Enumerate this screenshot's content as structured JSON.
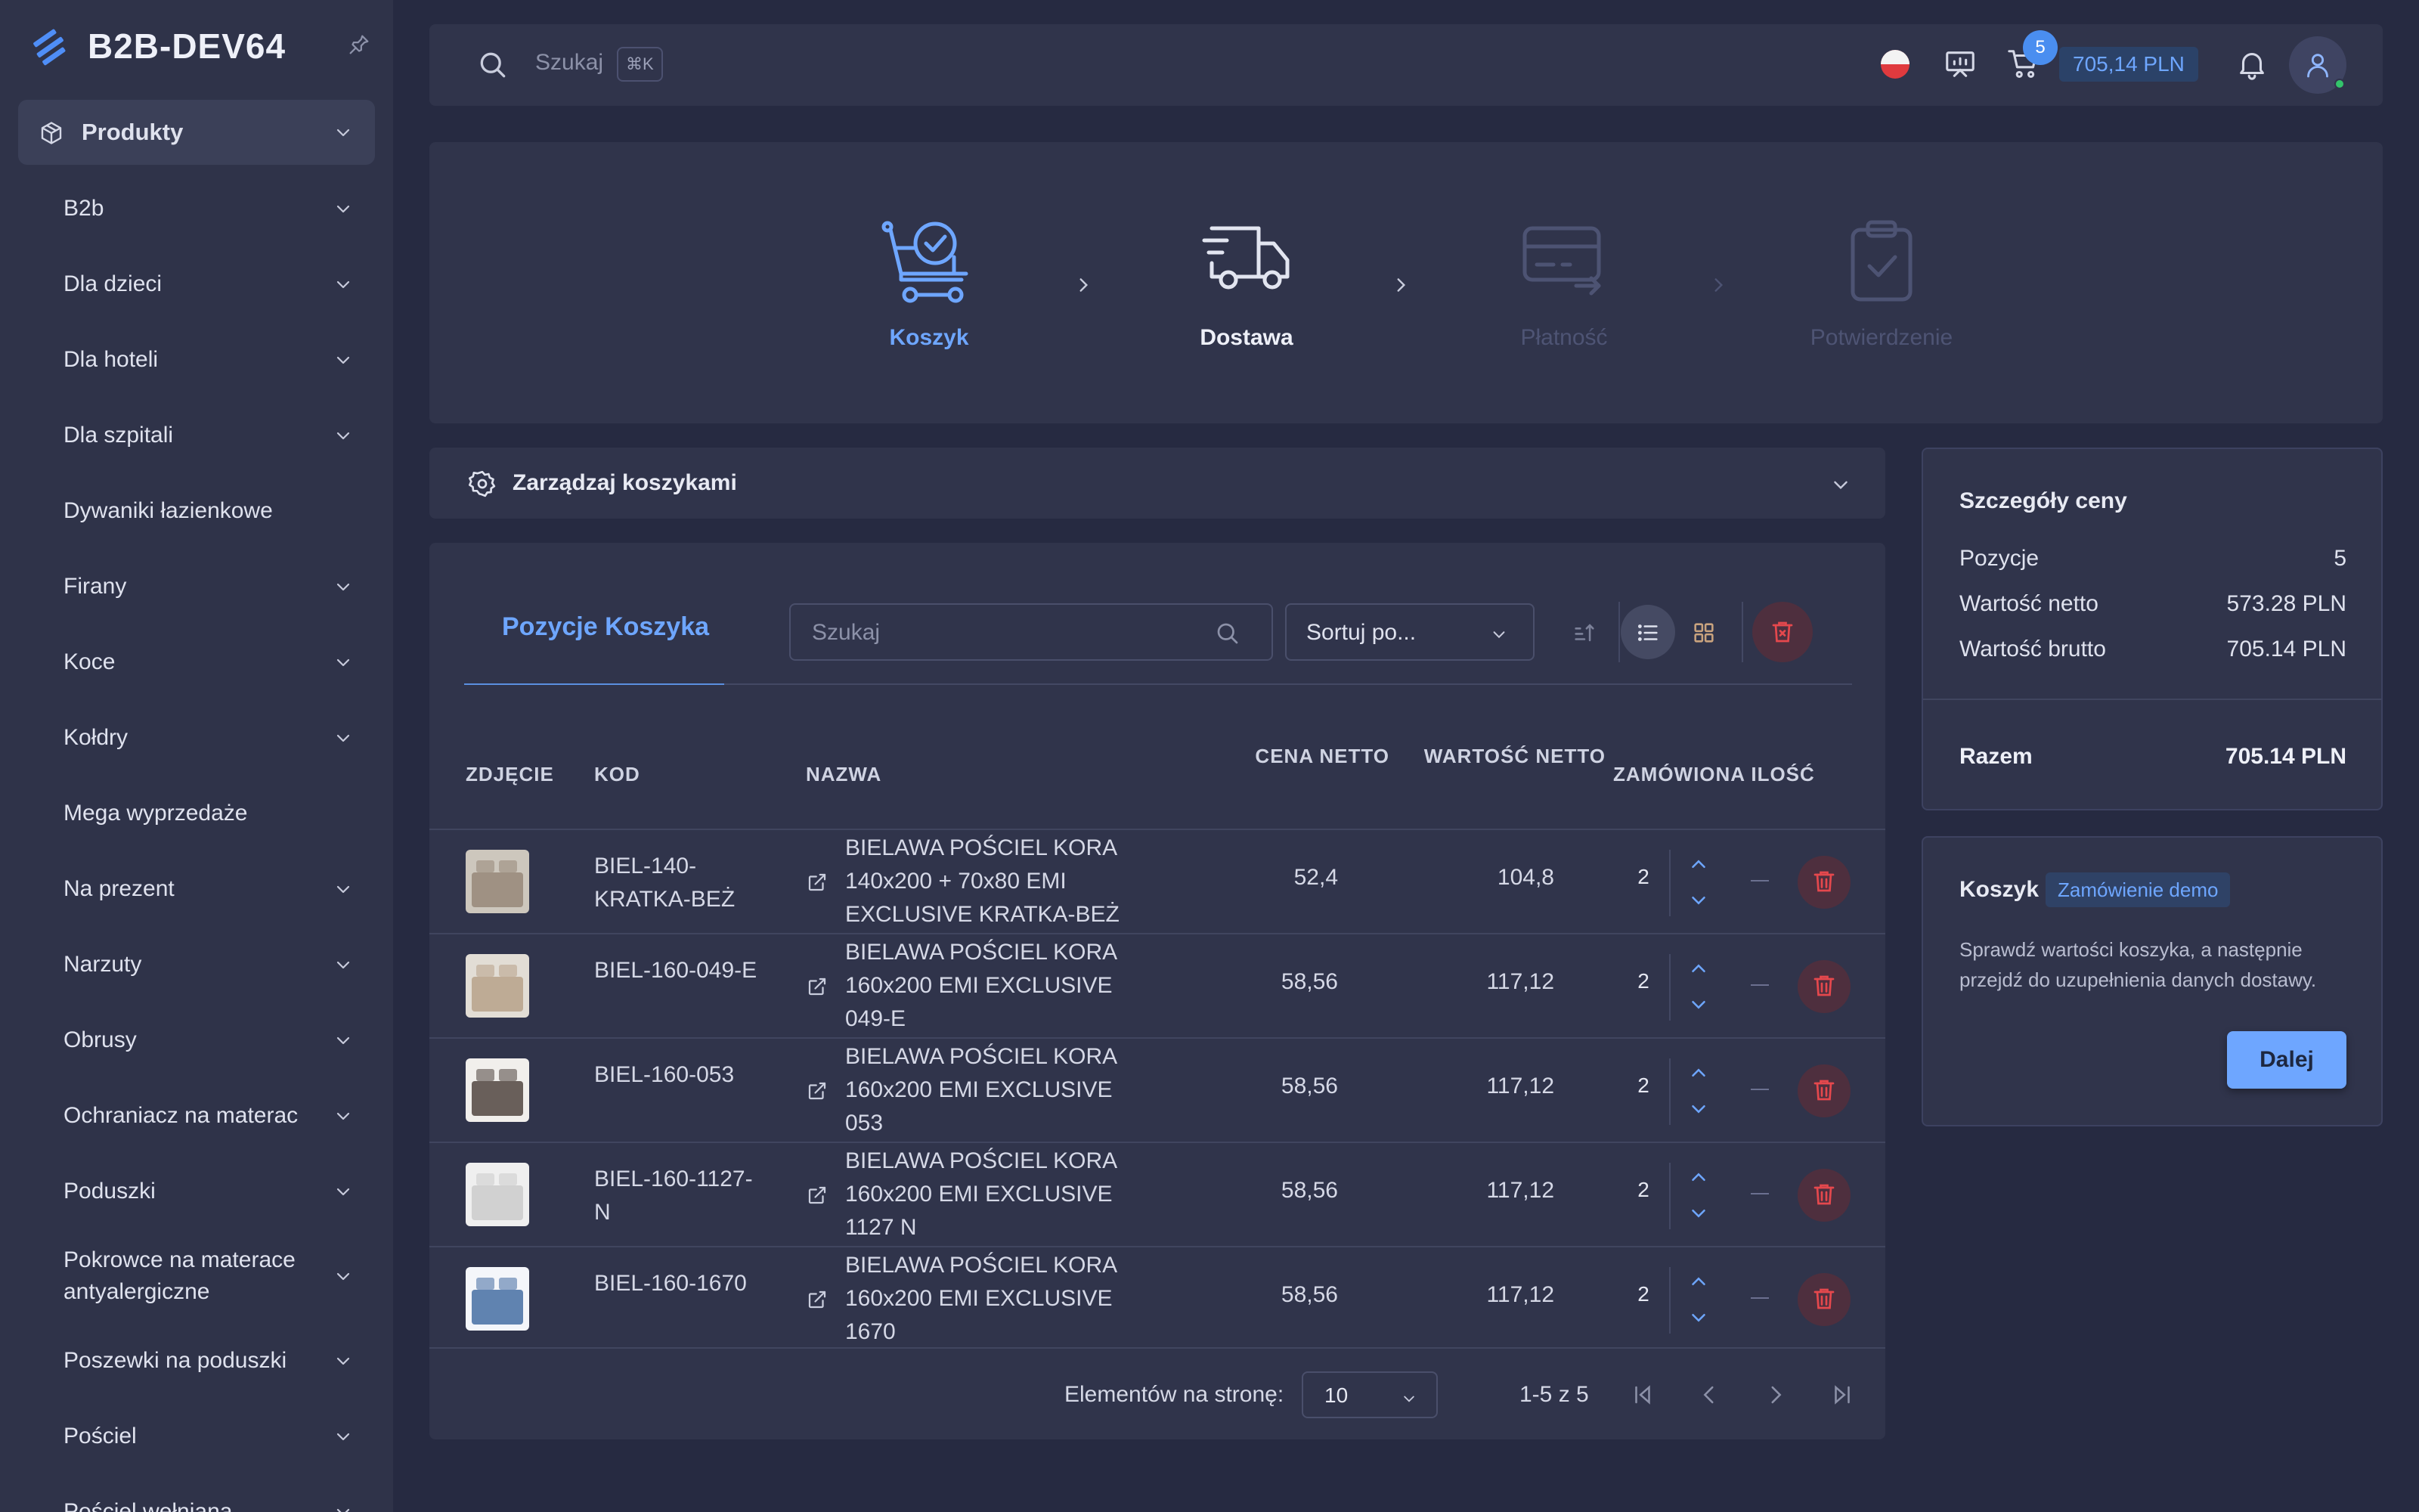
{
  "brand": {
    "name": "B2B-DEV64"
  },
  "sidebar": {
    "active": {
      "label": "Produkty"
    },
    "items": [
      {
        "label": "B2b",
        "expandable": true
      },
      {
        "label": "Dla dzieci",
        "expandable": true
      },
      {
        "label": "Dla hoteli",
        "expandable": true
      },
      {
        "label": "Dla szpitali",
        "expandable": true
      },
      {
        "label": "Dywaniki łazienkowe",
        "expandable": false
      },
      {
        "label": "Firany",
        "expandable": true
      },
      {
        "label": "Koce",
        "expandable": true
      },
      {
        "label": "Kołdry",
        "expandable": true
      },
      {
        "label": "Mega wyprzedaże",
        "expandable": false
      },
      {
        "label": "Na prezent",
        "expandable": true
      },
      {
        "label": "Narzuty",
        "expandable": true
      },
      {
        "label": "Obrusy",
        "expandable": true
      },
      {
        "label": "Ochraniacz na materac",
        "expandable": true
      },
      {
        "label": "Poduszki",
        "expandable": true
      },
      {
        "label": "Pokrowce na materace antyalergiczne",
        "expandable": true
      },
      {
        "label": "Poszewki na poduszki",
        "expandable": true
      },
      {
        "label": "Pościel",
        "expandable": true
      },
      {
        "label": "Pościel wełniana",
        "expandable": true
      }
    ]
  },
  "topbar": {
    "search_placeholder": "Szukaj",
    "shortcut": "⌘K",
    "cart_count": "5",
    "cart_amount": "705,14 PLN"
  },
  "steps": [
    {
      "label": "Koszyk",
      "state": "active"
    },
    {
      "label": "Dostawa",
      "state": "next"
    },
    {
      "label": "Płatność",
      "state": "disabled"
    },
    {
      "label": "Potwierdzenie",
      "state": "disabled"
    }
  ],
  "manage": {
    "label": "Zarządzaj koszykami"
  },
  "cart": {
    "tab_title": "Pozycje Koszyka",
    "search_placeholder": "Szukaj",
    "sort_label": "Sortuj po...",
    "columns": {
      "photo": "ZDJĘCIE",
      "code": "KOD",
      "name": "NAZWA",
      "price": "CENA NETTO",
      "value": "WARTOŚĆ NETTO",
      "qty": "ZAMÓWIONA ILOŚĆ"
    },
    "rows": [
      {
        "code": "BIEL-140-KRATKA-BEŻ",
        "name": "BIELAWA POŚCIEL KORA 140x200 + 70x80 EMI EXCLUSIVE KRATKA-BEŻ",
        "price": "52,4",
        "value": "104,8",
        "qty": "2"
      },
      {
        "code": "BIEL-160-049-E",
        "name": "BIELAWA POŚCIEL KORA 160x200 EMI EXCLUSIVE 049-E",
        "price": "58,56",
        "value": "117,12",
        "qty": "2"
      },
      {
        "code": "BIEL-160-053",
        "name": "BIELAWA POŚCIEL KORA 160x200 EMI EXCLUSIVE 053",
        "price": "58,56",
        "value": "117,12",
        "qty": "2"
      },
      {
        "code": "BIEL-160-1127-N",
        "name": "BIELAWA POŚCIEL KORA 160x200 EMI EXCLUSIVE 1127 N",
        "price": "58,56",
        "value": "117,12",
        "qty": "2"
      },
      {
        "code": "BIEL-160-1670",
        "name": "BIELAWA POŚCIEL KORA 160x200 EMI EXCLUSIVE 1670",
        "price": "58,56",
        "value": "117,12",
        "qty": "2"
      }
    ],
    "pager": {
      "per_page_label": "Elementów na stronę:",
      "per_page": "10",
      "range": "1-5 z 5"
    }
  },
  "price_details": {
    "title": "Szczegóły ceny",
    "positions_label": "Pozycje",
    "positions": "5",
    "net_label": "Wartość netto",
    "net": "573.28 PLN",
    "gross_label": "Wartość brutto",
    "gross": "705.14 PLN",
    "total_label": "Razem",
    "total": "705.14 PLN"
  },
  "cart_info": {
    "title": "Koszyk",
    "badge": "Zamówienie demo",
    "text": "Sprawdź wartości koszyka, a następnie przejdź do uzupełnienia danych dostawy.",
    "next_label": "Dalej"
  },
  "colors": {
    "accent": "#6ea6ff",
    "danger": "#e5484d",
    "bg": "#262a41",
    "panel": "#30344b"
  }
}
